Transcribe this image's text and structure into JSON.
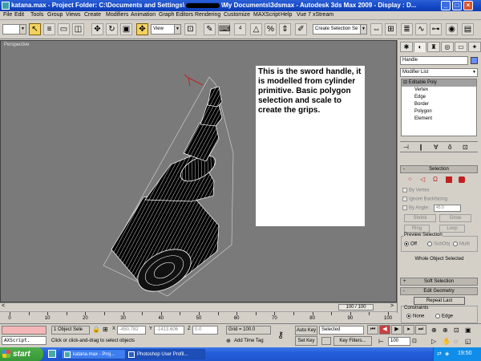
{
  "title": {
    "part1": "katana.max   - Project Folder: C:\\Documents and Settings\\",
    "part2": "\\My Documents\\3dsmax    - Autodesk 3ds Max  2009      - Display : D..."
  },
  "menu": [
    "File",
    "Edit",
    "Tools",
    "Group",
    "Views",
    "Create",
    "Modifiers",
    "Animation",
    "Graph Editors",
    "Rendering",
    "Customize",
    "MAXScript",
    "Help",
    "Vue 7 xStream"
  ],
  "toolbar": {
    "filter_value": "",
    "view_value": "View",
    "named_selection_placeholder": "Create Selection Se"
  },
  "viewport": {
    "label": "Perspective",
    "note": "This is the sword handle, it is modelled from cylinder primitive. Basic polygon selection and scale to create the grips."
  },
  "cmdpanel": {
    "object_name": "Handle",
    "modifier_list": "Modifier List",
    "stack": [
      "Editable Poly",
      "Vertex",
      "Edge",
      "Border",
      "Polygon",
      "Element"
    ],
    "selection_title": "Selection",
    "by_vertex": "By Vertex",
    "ignore_backfacing": "Ignore Backfacing",
    "by_angle": "By Angle:",
    "angle_value": "45.0",
    "shrink": "Shrink",
    "grow": "Grow",
    "ring": "Ring",
    "loop": "Loop",
    "preview_title": "Preview Selection",
    "preview_off": "Off",
    "preview_subobj": "SubObj",
    "preview_multi": "Multi",
    "whole_object": "Whole Object Selected",
    "soft_selection": "Soft Selection",
    "edit_geometry": "Edit Geometry",
    "repeat_last": "Repeat Last",
    "constraints": "Constraints",
    "none": "None",
    "edge": "Edge"
  },
  "timeline": {
    "frame": "100 / 100",
    "ticks": [
      "0",
      "10",
      "20",
      "30",
      "40",
      "50",
      "60",
      "70",
      "80",
      "90",
      "100"
    ]
  },
  "status": {
    "selection": "1 Object Sele",
    "x": "-450.782",
    "y": "-1413.606",
    "z": "0.0",
    "grid": "Grid = 100.0",
    "autokey": "Auto Key",
    "selected": "Selected",
    "setkey": "Set Key",
    "keyfilters": "Key Filters...",
    "prompt": "Click or click-and-drag to select objects",
    "addtimetag": "Add Time Tag",
    "frame_value": "100",
    "maxscript": "AXScript."
  },
  "taskbar": {
    "start": "start",
    "items": [
      "katana.max - Proj...",
      "Photoshop User Profil..."
    ],
    "clock": "19:50"
  },
  "colors": {
    "title_bar": "#1447c4",
    "viewport_bg": "#7a7a7a",
    "taskbar": "#245edb",
    "start": "#389837",
    "highlight": "#f2d25f"
  }
}
